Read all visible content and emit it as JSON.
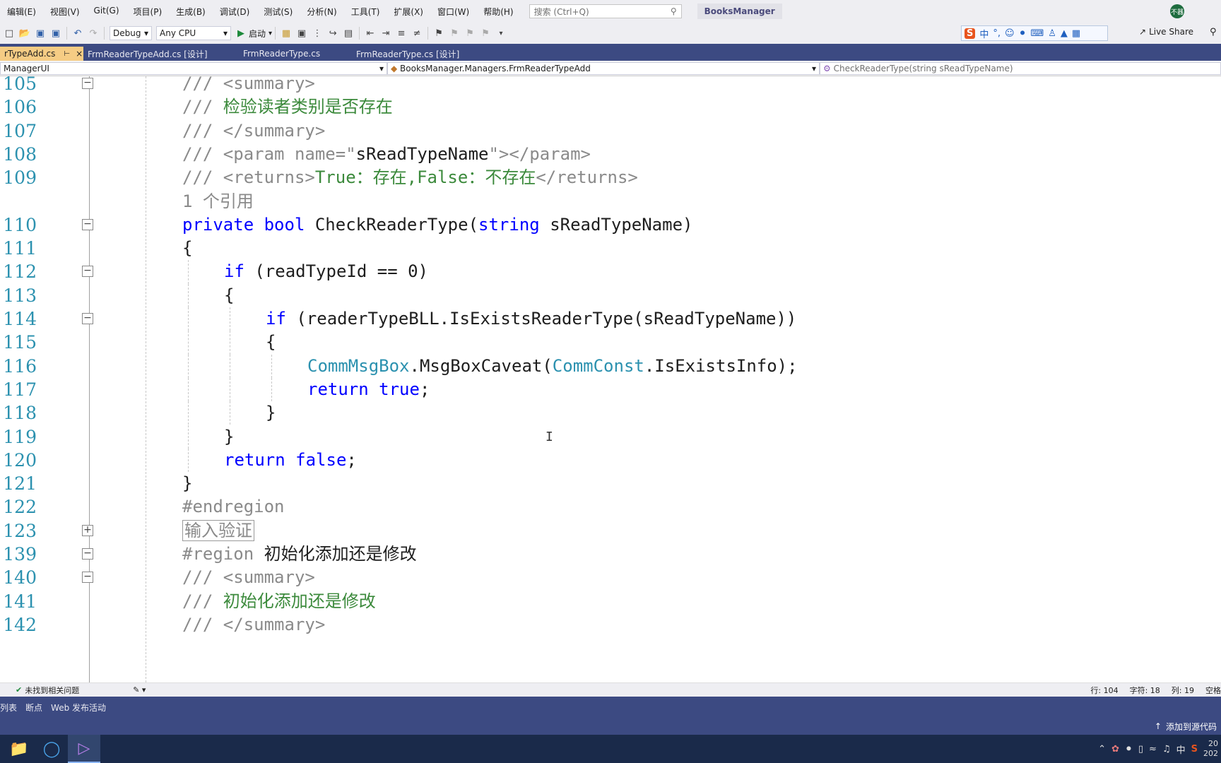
{
  "menu": {
    "items": [
      "编辑(E)",
      "视图(V)",
      "Git(G)",
      "项目(P)",
      "生成(B)",
      "调试(D)",
      "测试(S)",
      "分析(N)",
      "工具(T)",
      "扩展(X)",
      "窗口(W)",
      "帮助(H)"
    ],
    "search_placeholder": "搜索 (Ctrl+Q)",
    "app_name": "BooksManager",
    "avatar_text": "不器"
  },
  "toolbar": {
    "config": "Debug",
    "platform": "Any CPU",
    "start_label": "启动",
    "live_share": "Live Share"
  },
  "ime": {
    "lang": "中"
  },
  "tabs": [
    {
      "label": "rTypeAdd.cs",
      "active": true
    },
    {
      "label": "FrmReaderTypeAdd.cs [设计]",
      "active": false
    },
    {
      "label": "FrmReaderType.cs",
      "active": false
    },
    {
      "label": "FrmReaderType.cs [设计]",
      "active": false
    }
  ],
  "navbar": {
    "project": "ManagerUI",
    "class": "BooksManager.Managers.FrmReaderTypeAdd",
    "member": "CheckReaderType(string sReadTypeName)"
  },
  "code_lines": [
    {
      "num": "105",
      "segments": [
        {
          "t": "/// ",
          "c": "c-gray"
        },
        {
          "t": "<summary>",
          "c": "c-gray"
        }
      ],
      "indent": 0,
      "fold": "minus"
    },
    {
      "num": "106",
      "segments": [
        {
          "t": "/// ",
          "c": "c-gray"
        },
        {
          "t": "检验读者类别是否存在",
          "c": "c-green"
        }
      ],
      "indent": 0
    },
    {
      "num": "107",
      "segments": [
        {
          "t": "/// ",
          "c": "c-gray"
        },
        {
          "t": "</summary>",
          "c": "c-gray"
        }
      ],
      "indent": 0
    },
    {
      "num": "108",
      "segments": [
        {
          "t": "/// ",
          "c": "c-gray"
        },
        {
          "t": "<param name=\"",
          "c": "c-gray"
        },
        {
          "t": "sReadTypeName",
          "c": "c-dark"
        },
        {
          "t": "\"></param>",
          "c": "c-gray"
        }
      ],
      "indent": 0
    },
    {
      "num": "109",
      "segments": [
        {
          "t": "/// ",
          "c": "c-gray"
        },
        {
          "t": "<returns>",
          "c": "c-gray"
        },
        {
          "t": "True：存在,False：不存在",
          "c": "c-green"
        },
        {
          "t": "</returns>",
          "c": "c-gray"
        }
      ],
      "indent": 0
    },
    {
      "num": "",
      "segments": [
        {
          "t": "1 个引用",
          "c": "c-gray"
        }
      ],
      "indent": 0
    },
    {
      "num": "110",
      "segments": [
        {
          "t": "private ",
          "c": "c-blue"
        },
        {
          "t": "bool ",
          "c": "c-blue"
        },
        {
          "t": "CheckReaderType(",
          "c": "c-dark"
        },
        {
          "t": "string ",
          "c": "c-blue"
        },
        {
          "t": "sReadTypeName)",
          "c": "c-dark"
        }
      ],
      "indent": 0,
      "fold": "minus"
    },
    {
      "num": "111",
      "segments": [
        {
          "t": "{",
          "c": "c-dark"
        }
      ],
      "indent": 0
    },
    {
      "num": "112",
      "segments": [
        {
          "t": "if ",
          "c": "c-blue"
        },
        {
          "t": "(readTypeId == 0)",
          "c": "c-dark"
        }
      ],
      "indent": 1,
      "fold": "minus"
    },
    {
      "num": "113",
      "segments": [
        {
          "t": "{",
          "c": "c-dark"
        }
      ],
      "indent": 1
    },
    {
      "num": "114",
      "segments": [
        {
          "t": "if ",
          "c": "c-blue"
        },
        {
          "t": "(readerTypeBLL.IsExistsReaderType(sReadTypeName))",
          "c": "c-dark"
        }
      ],
      "indent": 2,
      "fold": "minus"
    },
    {
      "num": "115",
      "segments": [
        {
          "t": "{",
          "c": "c-dark"
        }
      ],
      "indent": 2
    },
    {
      "num": "116",
      "segments": [
        {
          "t": "CommMsgBox",
          "c": "c-teal"
        },
        {
          "t": ".MsgBoxCaveat(",
          "c": "c-dark"
        },
        {
          "t": "CommConst",
          "c": "c-teal"
        },
        {
          "t": ".IsExistsInfo);",
          "c": "c-dark"
        }
      ],
      "indent": 3
    },
    {
      "num": "117",
      "segments": [
        {
          "t": "return ",
          "c": "c-blue"
        },
        {
          "t": "true",
          "c": "c-blue"
        },
        {
          "t": ";",
          "c": "c-dark"
        }
      ],
      "indent": 3
    },
    {
      "num": "118",
      "segments": [
        {
          "t": "}",
          "c": "c-dark"
        }
      ],
      "indent": 2
    },
    {
      "num": "119",
      "segments": [
        {
          "t": "}",
          "c": "c-dark"
        }
      ],
      "indent": 1
    },
    {
      "num": "120",
      "segments": [
        {
          "t": "return ",
          "c": "c-blue"
        },
        {
          "t": "false",
          "c": "c-blue"
        },
        {
          "t": ";",
          "c": "c-dark"
        }
      ],
      "indent": 1
    },
    {
      "num": "121",
      "segments": [
        {
          "t": "}",
          "c": "c-dark"
        }
      ],
      "indent": 0
    },
    {
      "num": "122",
      "segments": [
        {
          "t": "#endregion",
          "c": "c-gray"
        }
      ],
      "indent": 0
    },
    {
      "num": "123",
      "segments": [
        {
          "t": "输入验证",
          "c": "region-box"
        }
      ],
      "indent": 0,
      "fold": "plus"
    },
    {
      "num": "139",
      "segments": [
        {
          "t": "#region ",
          "c": "c-gray"
        },
        {
          "t": "初始化添加还是修改",
          "c": "c-dark"
        }
      ],
      "indent": 0,
      "fold": "minus"
    },
    {
      "num": "140",
      "segments": [
        {
          "t": "/// ",
          "c": "c-gray"
        },
        {
          "t": "<summary>",
          "c": "c-gray"
        }
      ],
      "indent": 0,
      "fold": "minus"
    },
    {
      "num": "141",
      "segments": [
        {
          "t": "/// ",
          "c": "c-gray"
        },
        {
          "t": "初始化添加还是修改",
          "c": "c-green"
        }
      ],
      "indent": 0
    },
    {
      "num": "142",
      "segments": [
        {
          "t": "/// ",
          "c": "c-gray"
        },
        {
          "t": "</summary>",
          "c": "c-gray"
        }
      ],
      "indent": 0
    }
  ],
  "editor_status": {
    "issues": "未找到相关问题",
    "line": "行: 104",
    "char": "字符: 18",
    "col": "列: 19",
    "mode": "空格"
  },
  "tool_tabs": [
    "列表",
    "断点",
    "Web 发布活动"
  ],
  "statusbar": {
    "source_control": "添加到源代码"
  },
  "taskbar": {
    "tray_lang": "中",
    "clock_time": "20",
    "clock_date": "202"
  }
}
